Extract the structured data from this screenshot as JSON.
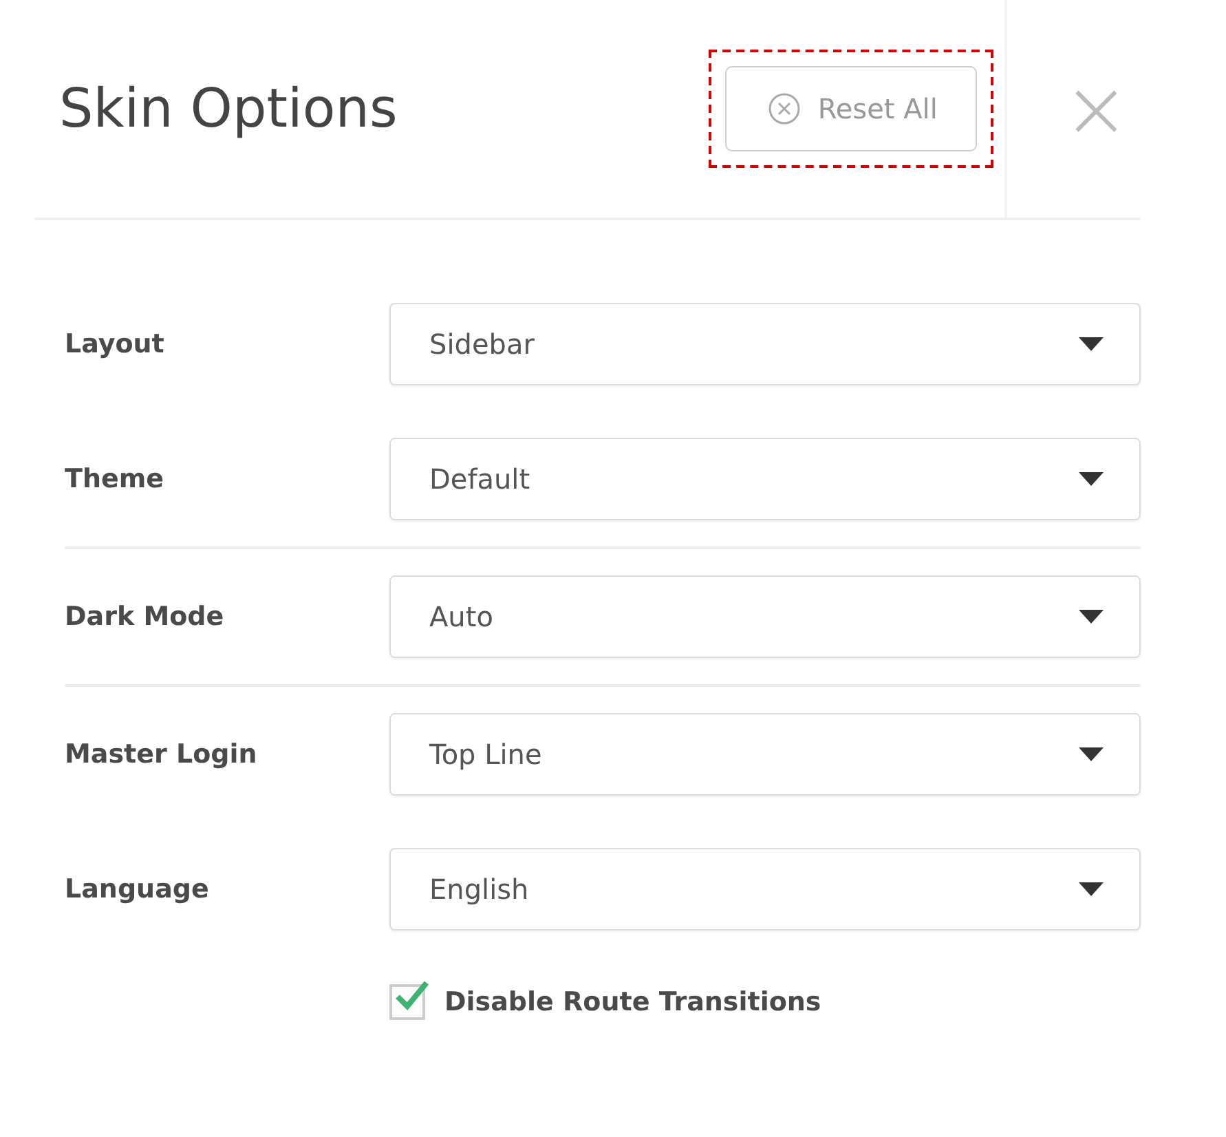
{
  "panel": {
    "title": "Skin Options",
    "reset_button": {
      "label": "Reset All",
      "highlighted": true
    },
    "close_icon": "×"
  },
  "sections": [
    {
      "rows": [
        {
          "label": "Layout",
          "value": "Sidebar"
        },
        {
          "label": "Theme",
          "value": "Default"
        }
      ]
    },
    {
      "rows": [
        {
          "label": "Dark Mode",
          "value": "Auto"
        }
      ]
    },
    {
      "rows": [
        {
          "label": "Master Login",
          "value": "Top Line"
        },
        {
          "label": "Language",
          "value": "English"
        }
      ]
    }
  ],
  "checkbox": {
    "label": "Disable Route Transitions",
    "checked": true
  }
}
